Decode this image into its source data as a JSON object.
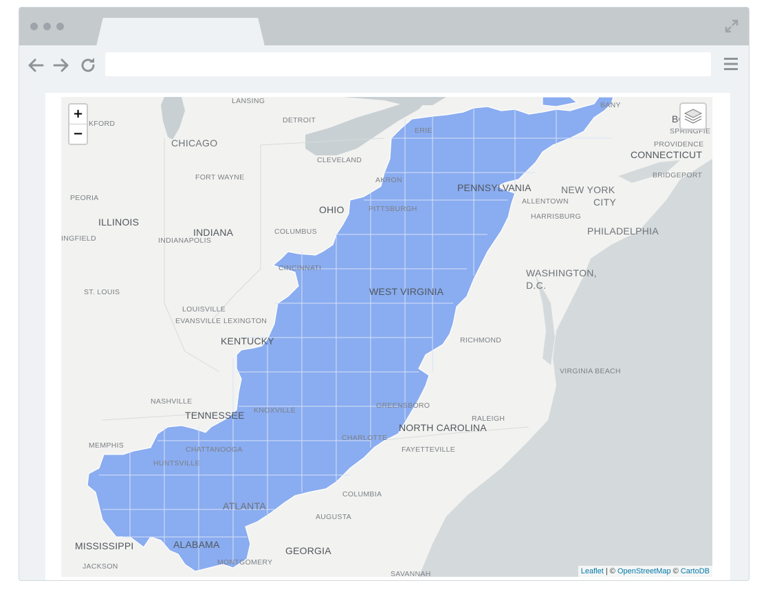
{
  "browser": {
    "address_value": "",
    "icons": {
      "back": "arrow-left-icon",
      "forward": "arrow-right-icon",
      "reload": "reload-icon",
      "menu": "hamburger-menu-icon",
      "expand": "expand-icon",
      "window_dots": "window-dots-icon"
    }
  },
  "map": {
    "zoom_in_label": "+",
    "zoom_out_label": "−",
    "layers_icon": "layers-icon",
    "highlight_color": "#8aacf0",
    "water_color": "#d4dadc",
    "land_color": "#f2f2f0",
    "attribution": {
      "leaflet": "Leaflet",
      "sep1": " | © ",
      "osm": "OpenStreetMap",
      "sep2": " © ",
      "carto": "CartoDB"
    },
    "labels": {
      "lansing": "LANSING",
      "detroit": "DETROIT",
      "albany": "BANY",
      "boston": "BO",
      "springfield_ma": "SPRINGFIE",
      "rockford": "KFORD",
      "chicago": "CHICAGO",
      "erie": "ERIE",
      "providence": "PROVIDENCE",
      "connecticut": "CONNECTICUT",
      "cleveland": "CLEVELAND",
      "akron": "AKRON",
      "fort_wayne": "FORT WAYNE",
      "bridgeport": "BRIDGEPORT",
      "pennsylvania": "PENNSYLVANIA",
      "new_york": "NEW YORK",
      "city": "CITY",
      "peoria": "PEORIA",
      "allentown": "ALLENTOWN",
      "ohio": "OHIO",
      "pittsburgh": "PITTSBURGH",
      "harrisburg": "HARRISBURG",
      "illinois": "ILLINOIS",
      "indiana": "INDIANA",
      "columbus": "COLUMBUS",
      "springfield_il": "INGFIELD",
      "indianapolis": "INDIANAPOLIS",
      "philadelphia": "PHILADELPHIA",
      "cincinnati": "CINCINNATI",
      "washington": "WASHINGTON,",
      "dc": "D.C.",
      "st_louis": "ST. LOUIS",
      "west_virginia": "WEST VIRGINIA",
      "louisville": "LOUISVILLE",
      "evansville": "EVANSVILLE",
      "lexington": "LEXINGTON",
      "kentucky": "KENTUCKY",
      "richmond": "RICHMOND",
      "virginia_beach": "VIRGINIA BEACH",
      "nashville": "NASHVILLE",
      "greensboro": "GREENSBORO",
      "tennessee": "TENNESSEE",
      "knoxville": "KNOXVILLE",
      "raleigh": "RALEIGH",
      "north_carolina": "NORTH CAROLINA",
      "memphis": "MEMPHIS",
      "charlotte": "CHARLOTTE",
      "fayetteville": "FAYETTEVILLE",
      "chattanooga": "CHATTANOOGA",
      "huntsville": "HUNTSVILLE",
      "columbia": "COLUMBIA",
      "atlanta": "ATLANTA",
      "augusta": "AUGUSTA",
      "mississippi": "MISSISSIPPI",
      "alabama": "ALABAMA",
      "georgia": "GEORGIA",
      "jackson": "JACKSON",
      "montgomery": "MONTGOMERY",
      "savannah": "SAVANNAH"
    }
  }
}
